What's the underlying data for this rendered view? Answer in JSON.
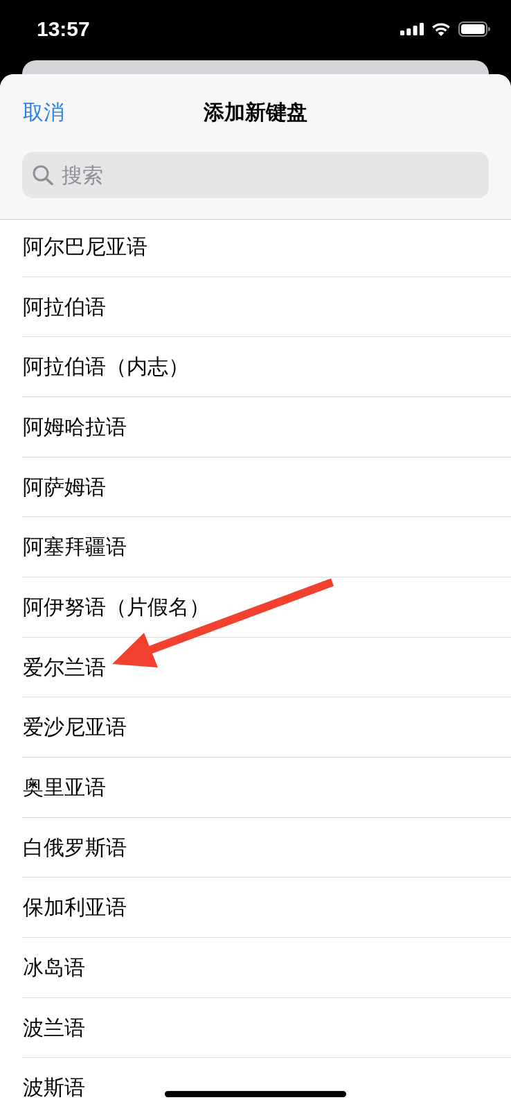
{
  "status_bar": {
    "time": "13:57"
  },
  "sheet": {
    "cancel": "取消",
    "title": "添加新键盘",
    "search": {
      "placeholder": "搜索"
    }
  },
  "languages": [
    "阿尔巴尼亚语",
    "阿拉伯语",
    "阿拉伯语（内志）",
    "阿姆哈拉语",
    "阿萨姆语",
    "阿塞拜疆语",
    "阿伊努语（片假名）",
    "爱尔兰语",
    "爱沙尼亚语",
    "奥里亚语",
    "白俄罗斯语",
    "保加利亚语",
    "冰岛语",
    "波兰语",
    "波斯语"
  ]
}
